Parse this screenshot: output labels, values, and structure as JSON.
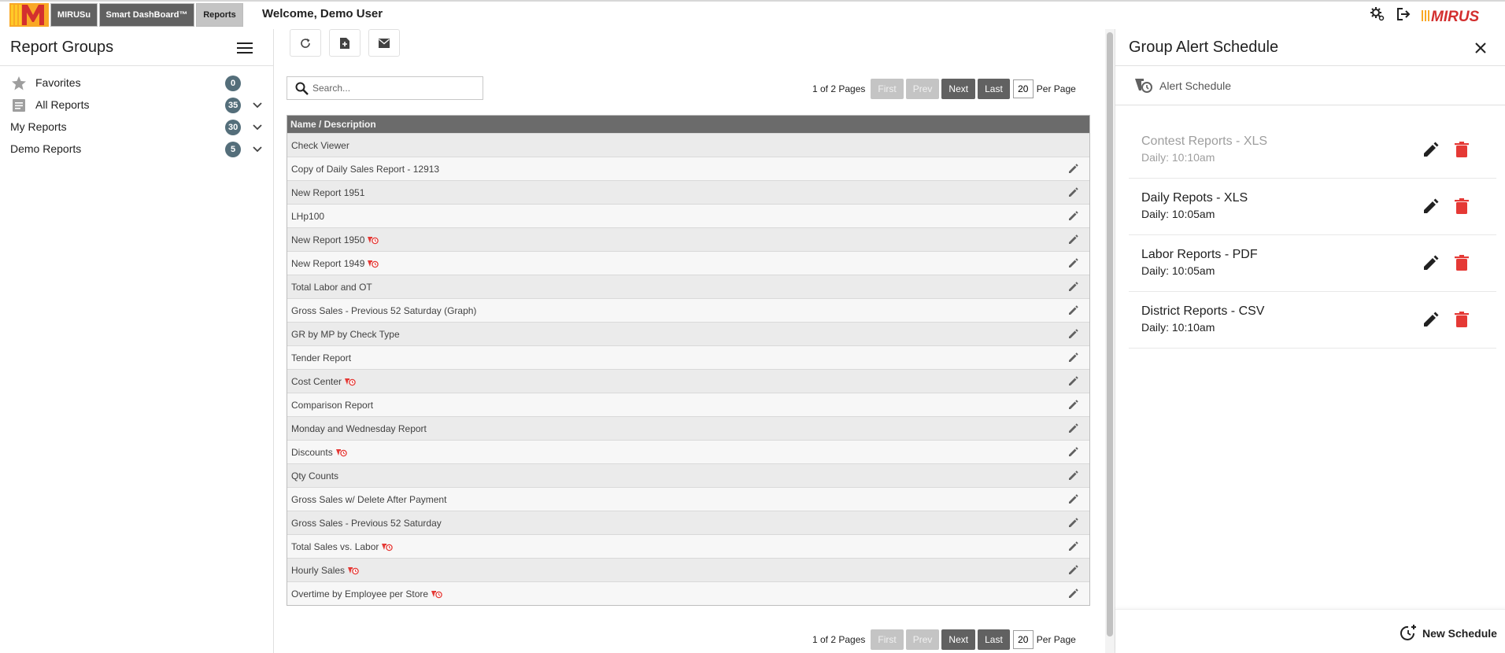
{
  "topbar": {
    "tabs": [
      {
        "label": "MIRUSu"
      },
      {
        "label": "Smart DashBoard™"
      },
      {
        "label": "Reports"
      }
    ],
    "welcome": "Welcome, Demo User",
    "brand": "MIRUS",
    "icons": [
      "settings-icon",
      "logout-icon"
    ]
  },
  "sidebar": {
    "title": "Report Groups",
    "groups": [
      {
        "label": "Favorites",
        "count": "0",
        "icon": "star-icon"
      },
      {
        "label": "All Reports",
        "count": "35",
        "icon": "list-icon"
      },
      {
        "label": "My Reports",
        "count": "30"
      },
      {
        "label": "Demo Reports",
        "count": "5"
      }
    ]
  },
  "main": {
    "search_placeholder": "Search...",
    "pager": {
      "info": "1 of 2 Pages",
      "first": "First",
      "prev": "Prev",
      "next": "Next",
      "last": "Last",
      "per_page": "20",
      "per_page_label": "Per Page"
    },
    "table": {
      "header": "Name / Description",
      "rows": [
        {
          "name": "Check Viewer",
          "alert": false,
          "editable": false
        },
        {
          "name": "Copy of Daily Sales Report - 12913",
          "alert": false,
          "editable": true
        },
        {
          "name": "New Report 1951",
          "alert": false,
          "editable": true
        },
        {
          "name": "LHp100",
          "alert": false,
          "editable": true
        },
        {
          "name": "New Report 1950",
          "alert": true,
          "editable": true
        },
        {
          "name": "New Report 1949",
          "alert": true,
          "editable": true
        },
        {
          "name": "Total Labor and OT",
          "alert": false,
          "editable": true
        },
        {
          "name": "Gross Sales - Previous 52 Saturday (Graph)",
          "alert": false,
          "editable": true
        },
        {
          "name": "GR by MP by Check Type",
          "alert": false,
          "editable": true
        },
        {
          "name": "Tender Report",
          "alert": false,
          "editable": true
        },
        {
          "name": "Cost Center",
          "alert": true,
          "editable": true
        },
        {
          "name": "Comparison Report",
          "alert": false,
          "editable": true
        },
        {
          "name": "Monday and Wednesday Report",
          "alert": false,
          "editable": true
        },
        {
          "name": "Discounts",
          "alert": true,
          "editable": true
        },
        {
          "name": "Qty Counts",
          "alert": false,
          "editable": true
        },
        {
          "name": "Gross Sales w/ Delete After Payment",
          "alert": false,
          "editable": true
        },
        {
          "name": "Gross Sales - Previous 52 Saturday",
          "alert": false,
          "editable": true
        },
        {
          "name": "Total Sales vs. Labor",
          "alert": true,
          "editable": true
        },
        {
          "name": "Hourly Sales",
          "alert": true,
          "editable": true
        },
        {
          "name": "Overtime by Employee per Store",
          "alert": true,
          "editable": true
        }
      ]
    }
  },
  "panel": {
    "title": "Group Alert Schedule",
    "subheader": "Alert Schedule",
    "schedules": [
      {
        "name": "Contest Reports - XLS",
        "time": "Daily: 10:10am",
        "dim": true
      },
      {
        "name": "Daily Repots - XLS",
        "time": "Daily: 10:05am",
        "dim": false
      },
      {
        "name": "Labor Reports - PDF",
        "time": "Daily: 10:05am",
        "dim": false
      },
      {
        "name": "District Reports - CSV",
        "time": "Daily: 10:10am",
        "dim": false
      }
    ],
    "new_schedule": "New Schedule"
  },
  "colors": {
    "accent_red": "#e53935",
    "badge": "#546e7a",
    "table_header": "#6b6b6b",
    "button_active": "#616161",
    "button_disabled": "#c4c4c4"
  }
}
